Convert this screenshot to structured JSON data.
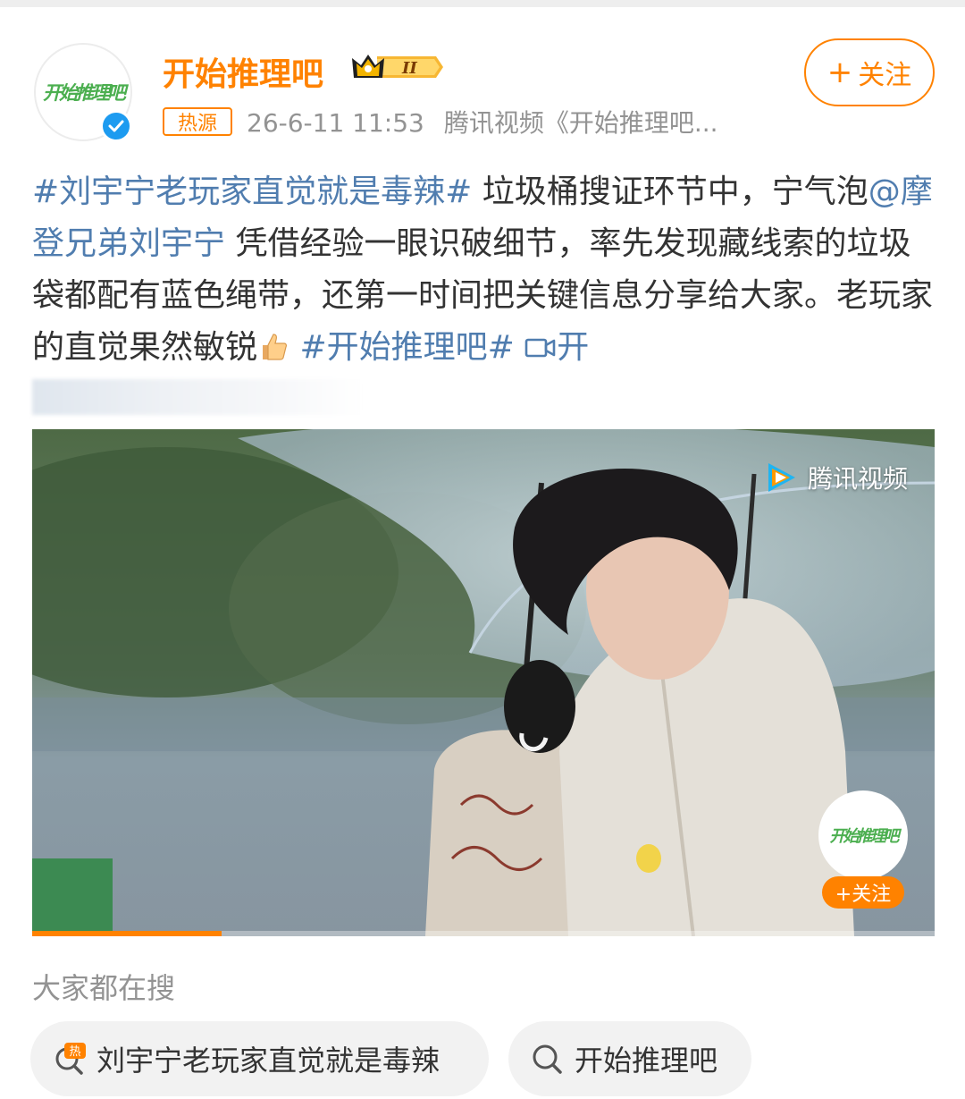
{
  "header": {
    "account_name": "开始推理吧",
    "avatar_text": "开始推理吧",
    "rank_badge": "II",
    "follow_label": "关注",
    "source_tag": "热源",
    "timestamp": "26-6-11 11:53",
    "source": "腾讯视频《开始推理吧..."
  },
  "post": {
    "hashtag_1": "#刘宇宁老玩家直觉就是毒辣#",
    "text_1": " 垃圾桶搜证环节中，宁气泡",
    "mention": "@摩登兄弟刘宇宁",
    "text_2": " 凭借经验一眼识破细节，率先发现藏线索的垃圾袋都配有蓝色绳带，还第一时间把关键信息分享给大家。老玩家的直觉果然敏锐",
    "hashtag_2": "#开始推理吧#",
    "video_link_icon": "video-camera-icon",
    "video_link_text": "开",
    "blurred_line": "开"
  },
  "video": {
    "watermark": "腾讯视频",
    "overlay_avatar_text": "开始推理吧",
    "overlay_follow_label": "+关注",
    "progress": 0.21
  },
  "searches": {
    "title": "大家都在搜",
    "items": [
      {
        "label": "刘宇宁老玩家直觉就是毒辣",
        "icon": "hot-search-icon"
      },
      {
        "label": "开始推理吧",
        "icon": "search-icon"
      }
    ]
  },
  "colors": {
    "accent": "#ff8200",
    "link": "#507daf",
    "verified": "#1d9bf0",
    "meta": "#939393"
  }
}
